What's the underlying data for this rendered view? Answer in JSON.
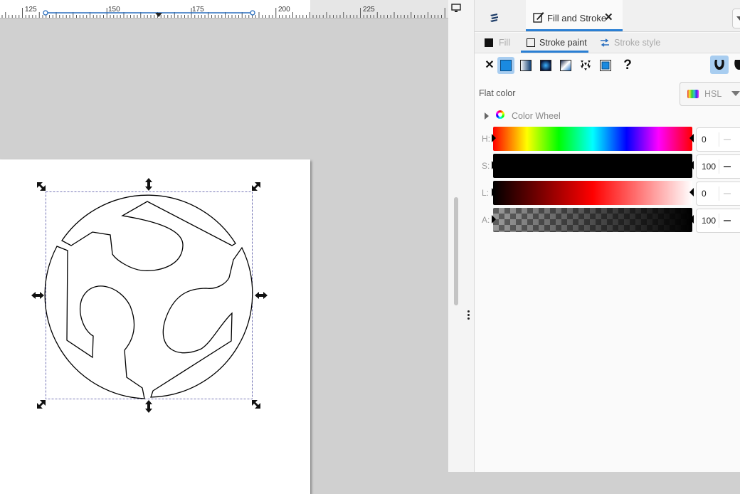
{
  "ruler": {
    "labels": [
      "125",
      "150",
      "175",
      "200",
      "225"
    ]
  },
  "panel": {
    "dock_tab_label": "Fill and Stroke",
    "dock_tab_close": "✕",
    "subtabs": {
      "fill": "Fill",
      "stroke_paint": "Stroke paint",
      "stroke_style": "Stroke style"
    },
    "paint_types": {
      "none": "✕",
      "unset": "?"
    },
    "flat_color_label": "Flat color",
    "mode_select": {
      "value": "HSL"
    },
    "color_wheel_label": "Color Wheel",
    "sliders": [
      {
        "channel": "H:",
        "value": "0"
      },
      {
        "channel": "S:",
        "value": "100"
      },
      {
        "channel": "L:",
        "value": "0"
      },
      {
        "channel": "A:",
        "value": "100"
      }
    ]
  },
  "colors": {
    "accent": "#2a7fd4",
    "selected_button": "#a8cdf0",
    "stroke": "#000000"
  }
}
